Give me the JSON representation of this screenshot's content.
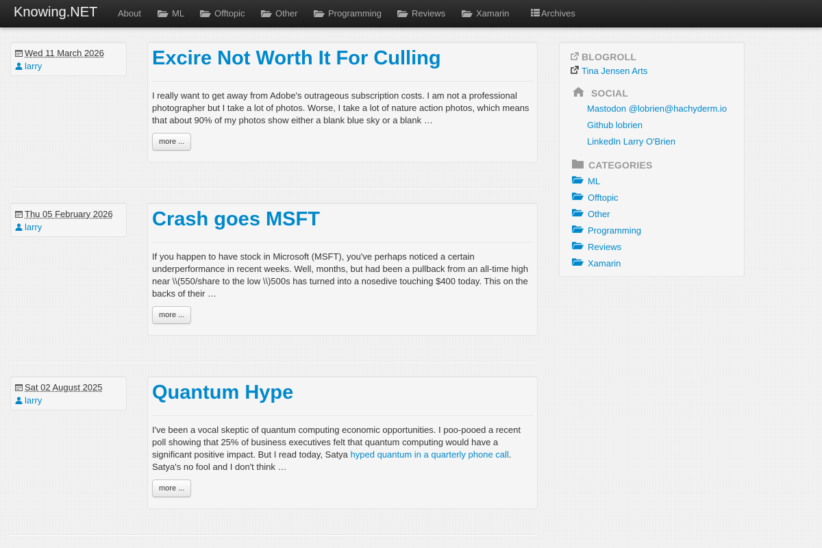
{
  "navbar": {
    "brand": "Knowing.NET",
    "items": [
      {
        "label": "About",
        "icon": "none"
      },
      {
        "label": "ML",
        "icon": "folder-open-icon"
      },
      {
        "label": "Offtopic",
        "icon": "folder-open-icon"
      },
      {
        "label": "Other",
        "icon": "folder-open-icon"
      },
      {
        "label": "Programming",
        "icon": "folder-open-icon"
      },
      {
        "label": "Reviews",
        "icon": "folder-open-icon"
      },
      {
        "label": "Xamarin",
        "icon": "folder-open-icon"
      },
      {
        "label": "Archives",
        "icon": "list-icon"
      }
    ]
  },
  "posts": [
    {
      "date": "Wed 11 March 2026",
      "author": "larry",
      "title": "Excire Not Worth It For Culling",
      "excerpt": "I really want to get away from Adobe's outrageous subscription costs. I am not a professional photographer but I take a lot of photos. Worse, I take a lot of nature action photos, which means that about 90% of my photos show either a blank blue sky or a blank …",
      "more_label": "more ..."
    },
    {
      "date": "Thu 05 February 2026",
      "author": "larry",
      "title": "Crash goes MSFT",
      "excerpt": "If you happen to have stock in Microsoft (MSFT), you've perhaps noticed a certain underperformance in recent weeks. Well, months, but had been a pullback from an all-time high near \\\\(550/share to the low \\\\)500s has turned into a nosedive touching $400 today. This on the backs of their …",
      "more_label": "more ..."
    },
    {
      "date": "Sat 02 August 2025",
      "author": "larry",
      "title": "Quantum Hype",
      "excerpt_before": "I've been a vocal skeptic of quantum computing economic opportunities. I poo-pooed a recent poll showing that 25% of business executives felt that quantum computing would have a significant positive impact. But I read today, Satya ",
      "excerpt_link": "hyped quantum in a quarterly phone call",
      "excerpt_after": ". Satya's no fool and I don't think …",
      "more_label": "more ..."
    }
  ],
  "sidebar": {
    "blogroll": {
      "header": "BLOGROLL",
      "links": [
        "Tina Jensen Arts"
      ]
    },
    "social": {
      "header": "SOCIAL",
      "links": [
        "Mastodon @lobrien@hachyderm.io",
        "Github lobrien",
        "LinkedIn Larry O'Brien"
      ]
    },
    "categories": {
      "header": "CATEGORIES",
      "links": [
        "ML",
        "Offtopic",
        "Other",
        "Programming",
        "Reviews",
        "Xamarin"
      ]
    }
  },
  "colors": {
    "accent": "#0088cc",
    "navbar": "#222222",
    "panel": "#f5f5f5"
  }
}
